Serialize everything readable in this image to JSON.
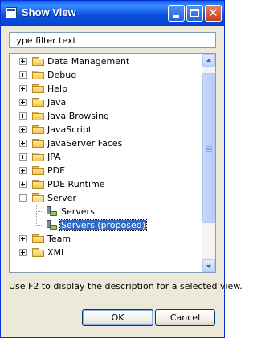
{
  "window": {
    "title": "Show View"
  },
  "filter": {
    "value": "type filter text"
  },
  "tree": {
    "items": [
      {
        "label": "Data Management",
        "type": "folder",
        "expanded": false,
        "level": 0
      },
      {
        "label": "Debug",
        "type": "folder",
        "expanded": false,
        "level": 0
      },
      {
        "label": "Help",
        "type": "folder",
        "expanded": false,
        "level": 0
      },
      {
        "label": "Java",
        "type": "folder",
        "expanded": false,
        "level": 0
      },
      {
        "label": "Java Browsing",
        "type": "folder",
        "expanded": false,
        "level": 0
      },
      {
        "label": "JavaScript",
        "type": "folder",
        "expanded": false,
        "level": 0
      },
      {
        "label": "JavaServer Faces",
        "type": "folder",
        "expanded": false,
        "level": 0
      },
      {
        "label": "JPA",
        "type": "folder",
        "expanded": false,
        "level": 0
      },
      {
        "label": "PDE",
        "type": "folder",
        "expanded": false,
        "level": 0
      },
      {
        "label": "PDE Runtime",
        "type": "folder",
        "expanded": false,
        "level": 0
      },
      {
        "label": "Server",
        "type": "folder",
        "expanded": true,
        "level": 0
      },
      {
        "label": "Servers",
        "type": "view",
        "icon": "servers-view-icon",
        "level": 1
      },
      {
        "label": "Servers (proposed)",
        "type": "view",
        "icon": "servers-view-icon",
        "level": 1,
        "selected": true
      },
      {
        "label": "Team",
        "type": "folder",
        "expanded": false,
        "level": 0
      },
      {
        "label": "XML",
        "type": "folder",
        "expanded": false,
        "level": 0
      }
    ]
  },
  "scrollbar": {
    "position": 0.15,
    "visible_fraction": 0.78
  },
  "description": "Use F2 to display the description for a selected view.",
  "buttons": {
    "ok": "OK",
    "cancel": "Cancel"
  },
  "colors": {
    "titlebar": "#0a5ff0",
    "selection": "#316ac5",
    "dialog_bg": "#ece9d8"
  }
}
